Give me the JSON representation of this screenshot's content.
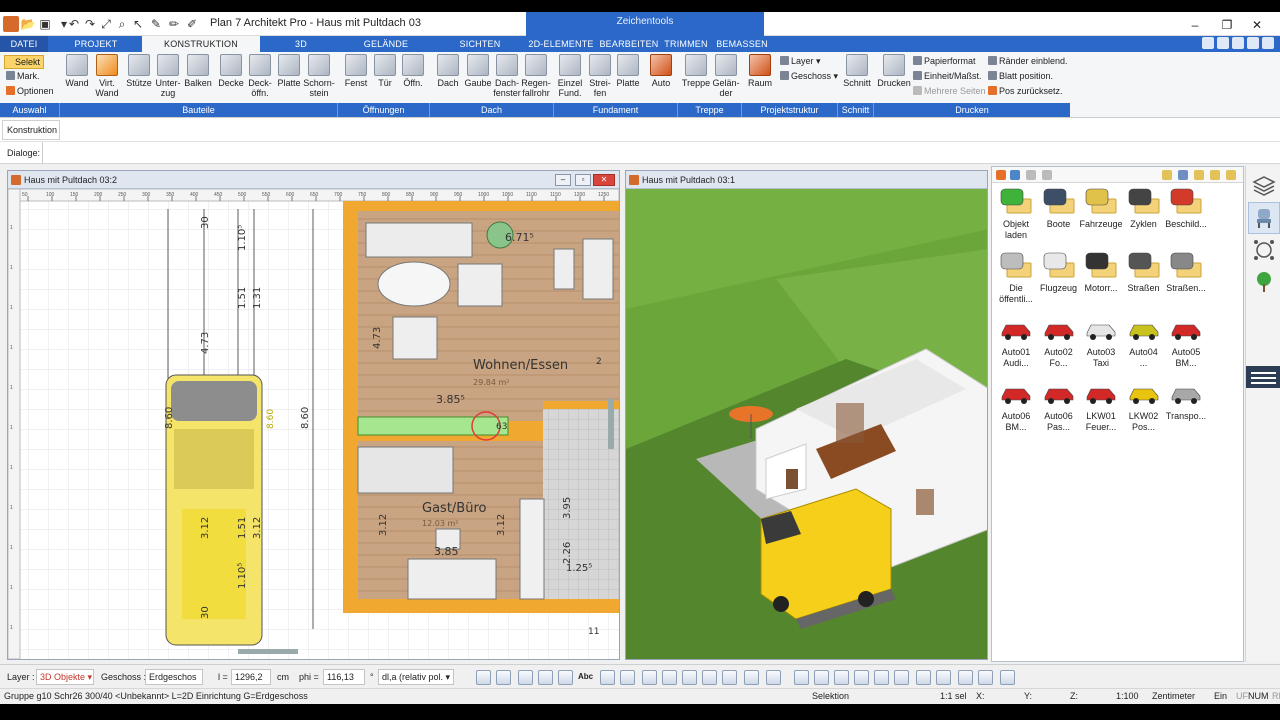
{
  "window": {
    "title": "Plan 7 Architekt Pro - Haus mit Pultdach 03",
    "context_tab": "Zeichentools",
    "min": "–",
    "max": "❐",
    "close": "✕"
  },
  "ribbon_tabs": [
    "DATEI",
    "PROJEKT",
    "KONSTRUKTION",
    "3D",
    "GELÄNDE",
    "SICHTEN",
    "2D-ELEMENTE",
    "BEARBEITEN",
    "TRIMMEN",
    "BEMASSEN"
  ],
  "ribbon": {
    "selection": {
      "selekt": "Selekt",
      "mark": "Mark.",
      "optionen": "Optionen"
    },
    "buttons": [
      {
        "label": "Wand",
        "line2": ""
      },
      {
        "label": "Virt.",
        "line2": "Wand"
      },
      {
        "label": "Stütze",
        "line2": ""
      },
      {
        "label": "Unter-",
        "line2": "zug"
      },
      {
        "label": "Balken",
        "line2": ""
      },
      {
        "label": "Decke",
        "line2": ""
      },
      {
        "label": "Deck-",
        "line2": "öffn."
      },
      {
        "label": "Platte",
        "line2": ""
      },
      {
        "label": "Schorn-",
        "line2": "stein"
      },
      {
        "label": "Fenst",
        "line2": ""
      },
      {
        "label": "Tür",
        "line2": ""
      },
      {
        "label": "Öffn.",
        "line2": ""
      },
      {
        "label": "Dach",
        "line2": ""
      },
      {
        "label": "Gaube",
        "line2": ""
      },
      {
        "label": "Dach-",
        "line2": "fenster"
      },
      {
        "label": "Regen-",
        "line2": "fallrohr"
      },
      {
        "label": "Einzel",
        "line2": "Fund."
      },
      {
        "label": "Strei-",
        "line2": "fen"
      },
      {
        "label": "Platte",
        "line2": ""
      },
      {
        "label": "Auto",
        "line2": ""
      },
      {
        "label": "Treppe",
        "line2": ""
      },
      {
        "label": "Gelän-",
        "line2": "der"
      },
      {
        "label": "Raum",
        "line2": ""
      },
      {
        "label": "Schnitt",
        "line2": ""
      },
      {
        "label": "Drucken",
        "line2": ""
      }
    ],
    "layer_menu": "Layer",
    "geschoss_menu": "Geschoss",
    "print_small": [
      "Papierformat",
      "Einheit/Maßst.",
      "Mehrere Seiten"
    ],
    "print_small2": [
      "Ränder einblend.",
      "Blatt position.",
      "Pos zurücksetz."
    ],
    "groups": [
      "Auswahl",
      "Bauteile",
      "Öffnungen",
      "Dach",
      "Fundament",
      "Treppe",
      "Projektstruktur",
      "Schnitt",
      "Drucken"
    ]
  },
  "toolbar": {
    "konstruktion": "Konstruktion",
    "dialoge": "Dialoge:"
  },
  "plan_window": {
    "title": "Haus mit Pultdach 03:2",
    "ruler_ticks": [
      "50",
      "100",
      "150",
      "200",
      "250",
      "300",
      "350",
      "400",
      "450",
      "500",
      "550",
      "600",
      "650",
      "700",
      "750",
      "800",
      "850",
      "900",
      "950",
      "1000",
      "1050",
      "1100",
      "1150",
      "1200",
      "1250"
    ],
    "rooms": [
      {
        "name": "Wohnen/Essen",
        "area": "29.84 m²"
      },
      {
        "name": "Gast/Büro",
        "area": "12.03 m²"
      }
    ],
    "dims_left": [
      "30",
      "1.10⁵",
      "4.73",
      "1.51",
      "1.31",
      "8.60",
      "8.60",
      "8.60",
      "3.12",
      "1.51",
      "3.12",
      "1.10⁵",
      "30"
    ],
    "dims_plan": [
      "4.73",
      "3.85⁵",
      "3.12",
      "3.12",
      "3.95",
      "2.26",
      "1.25⁵",
      "3.85",
      "6.71⁵",
      "63",
      "2",
      "11"
    ]
  },
  "view3d_window": {
    "title": "Haus mit Pultdach 03:1"
  },
  "library": {
    "items": [
      {
        "line1": "Objekt",
        "line2": "laden",
        "icon": "folder-green-icon"
      },
      {
        "line1": "Boote",
        "line2": "",
        "icon": "boat-folder-icon"
      },
      {
        "line1": "Fahrzeuge",
        "line2": "",
        "icon": "car-folder-icon"
      },
      {
        "line1": "Zyklen",
        "line2": "",
        "icon": "bicycle-folder-icon"
      },
      {
        "line1": "Beschild...",
        "line2": "",
        "icon": "stop-sign-folder-icon"
      },
      {
        "line1": "Die",
        "line2": "öffentli...",
        "icon": "bus-folder-icon"
      },
      {
        "line1": "Flugzeug",
        "line2": "",
        "icon": "plane-folder-icon"
      },
      {
        "line1": "Motorr...",
        "line2": "",
        "icon": "motorbike-folder-icon"
      },
      {
        "line1": "Straßen",
        "line2": "",
        "icon": "road-folder-icon"
      },
      {
        "line1": "Straßen...",
        "line2": "",
        "icon": "streetlamp-folder-icon"
      },
      {
        "line1": "Auto01",
        "line2": "Audi...",
        "icon": "red-car-icon"
      },
      {
        "line1": "Auto02",
        "line2": "Fo...",
        "icon": "red-car-icon"
      },
      {
        "line1": "Auto03",
        "line2": "Taxi",
        "icon": "white-car-icon"
      },
      {
        "line1": "Auto04",
        "line2": "...",
        "icon": "yellow-car-icon"
      },
      {
        "line1": "Auto05",
        "line2": "BM...",
        "icon": "red-car-icon"
      },
      {
        "line1": "Auto06",
        "line2": "BM...",
        "icon": "red-car-icon"
      },
      {
        "line1": "Auto06",
        "line2": "Pas...",
        "icon": "red-car-icon"
      },
      {
        "line1": "LKW01",
        "line2": "Feuer...",
        "icon": "firetruck-icon"
      },
      {
        "line1": "LKW02",
        "line2": "Pos...",
        "icon": "yellow-truck-icon"
      },
      {
        "line1": "Transpo...",
        "line2": "",
        "icon": "grey-van-icon"
      }
    ]
  },
  "bottombar": {
    "layer_label": "Layer :",
    "layer_value": "3D Objekte",
    "geschoss_label": "Geschoss :",
    "geschoss_value": "Erdgeschos",
    "l_label": "l =",
    "l_value": "1296,2",
    "l_unit": "cm",
    "phi_label": "phi =",
    "phi_value": "116,13",
    "phi_unit": "°",
    "mode_value": "dl,a (relativ pol.",
    "abc": "Abc"
  },
  "statusbar": {
    "info": "Gruppe g10 Schr26 300/40 <Unbekannt> L=2D Einrichtung G=Erdgeschoss",
    "mode": "Selektion",
    "sel": "1:1 sel",
    "x": "X:",
    "y": "Y:",
    "z": "Z:",
    "scale": "1:100",
    "unit": "Zentimeter",
    "ein": "Ein",
    "uf": "UF",
    "num": "NUM",
    "rf": "RF"
  },
  "colors": {
    "ribbon_blue": "#2c68c8",
    "wall_orange": "#f0a830",
    "floor_wood": "#c9a482",
    "grass": "#6aa63c",
    "van_yellow": "#f5cf1a"
  }
}
